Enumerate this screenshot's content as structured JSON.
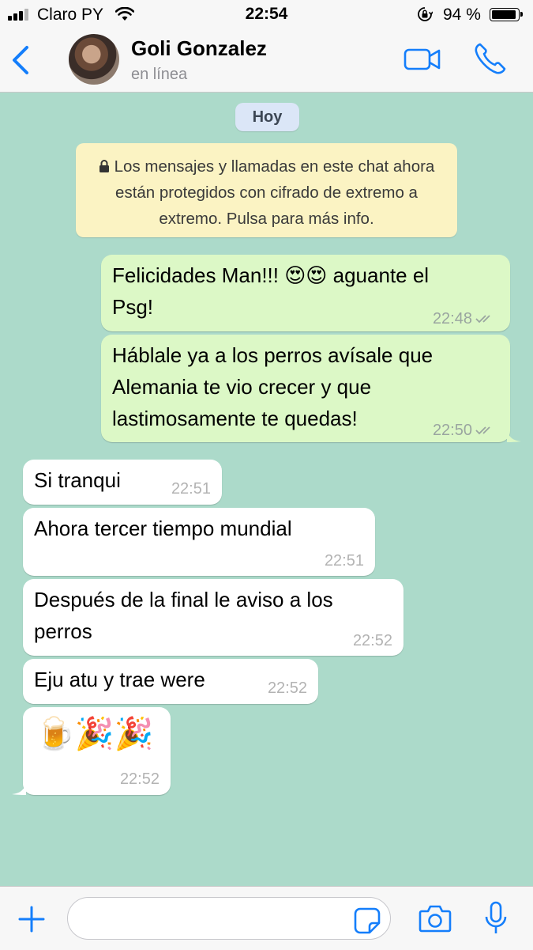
{
  "status_bar": {
    "carrier": "Claro PY",
    "time": "22:54",
    "battery_percent": "94 %",
    "battery_level": 0.94,
    "signal_bars": 3
  },
  "header": {
    "back_icon": "chevron-left-icon",
    "contact_name": "Goli Gonzalez",
    "contact_status": "en línea",
    "accent_color": "#147efb"
  },
  "chat": {
    "background_color": "#acdaca",
    "date_label": "Hoy",
    "system_note": "Los mensajes y llamadas en este chat ahora están protegidos con cifrado de extremo a extremo. Pulsa para más info.",
    "messages": [
      {
        "direction": "out",
        "lines": [
          "Felicidades Man!!! 😍😍 aguante el",
          "Psg!"
        ],
        "time": "22:48",
        "status": "read"
      },
      {
        "direction": "out",
        "lines": [
          "Háblale ya a los perros avísale que",
          "Alemania te vio crecer y que",
          "lastimosamente te quedas!"
        ],
        "time": "22:50",
        "status": "read"
      },
      {
        "direction": "in",
        "lines": [
          "Si tranqui"
        ],
        "time": "22:51"
      },
      {
        "direction": "in",
        "lines": [
          "Ahora tercer tiempo mundial"
        ],
        "time": "22:51"
      },
      {
        "direction": "in",
        "lines": [
          "Después de la final le aviso a los",
          "perros"
        ],
        "time": "22:52"
      },
      {
        "direction": "in",
        "lines": [
          "Eju atu y trae were"
        ],
        "time": "22:52"
      },
      {
        "direction": "in",
        "lines": [
          "🍺🎉🎉"
        ],
        "time": "22:52"
      }
    ]
  },
  "input_bar": {
    "placeholder": "",
    "icons": [
      "plus-icon",
      "sticker-icon",
      "camera-icon",
      "microphone-icon"
    ]
  }
}
